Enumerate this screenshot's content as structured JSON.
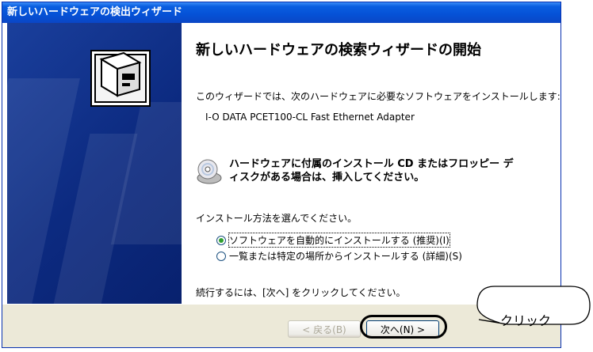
{
  "window": {
    "title": "新しいハードウェアの検出ウィザード"
  },
  "content": {
    "heading": "新しいハードウェアの検索ウィザードの開始",
    "intro": "このウィザードでは、次のハードウェアに必要なソフトウェアをインストールします:",
    "device": "I-O DATA PCET100-CL Fast Ethernet Adapter",
    "cd_prompt": "ハードウェアに付属のインストール CD またはフロッピー ディスクがある場合は、挿入してください。",
    "choose_prompt": "インストール方法を選んでください。",
    "options": [
      {
        "label": "ソフトウェアを自動的にインストールする (推奨)(I)",
        "selected": true
      },
      {
        "label": "一覧または特定の場所からインストールする (詳細)(S)",
        "selected": false
      }
    ],
    "continue_prompt": "続行するには、[次へ] をクリックしてください。"
  },
  "buttons": {
    "back": "< 戻る(B)",
    "next": "次へ(N) >"
  },
  "annotation": {
    "callout": "クリック"
  },
  "colors": {
    "titlebar": "#0a5ee0",
    "sidebar": "#0c2a80",
    "footer": "#ece9d8"
  }
}
